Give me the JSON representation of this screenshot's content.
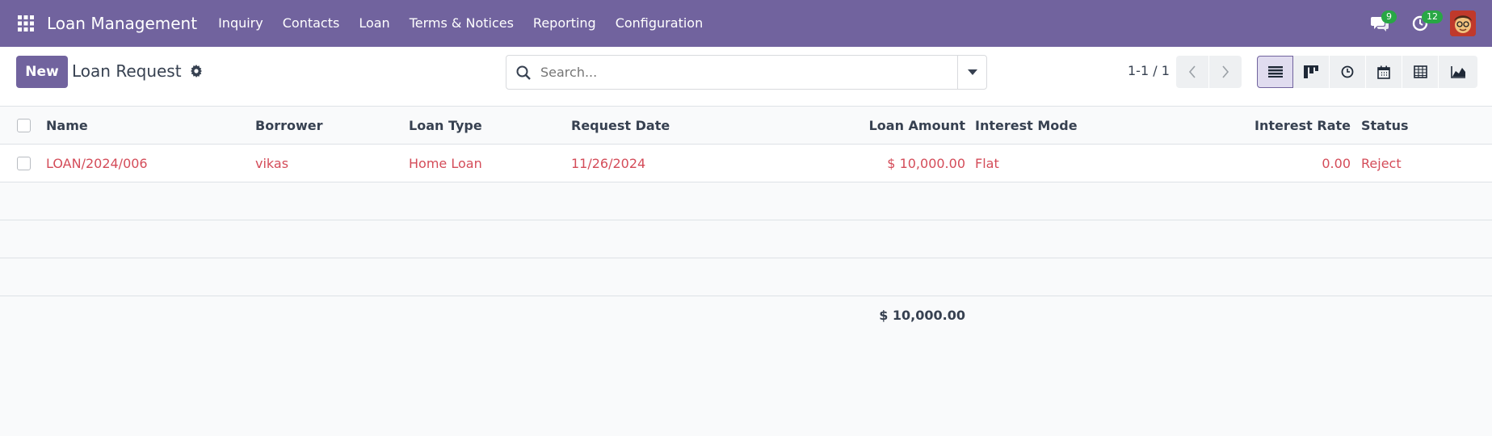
{
  "app": {
    "name": "Loan Management",
    "menu": [
      "Inquiry",
      "Contacts",
      "Loan",
      "Terms & Notices",
      "Reporting",
      "Configuration"
    ],
    "messages_count": "9",
    "activities_count": "12"
  },
  "control": {
    "new_label": "New",
    "breadcrumb": "Loan Request",
    "search_placeholder": "Search...",
    "pager": "1-1 / 1"
  },
  "table": {
    "columns": {
      "name": "Name",
      "borrower": "Borrower",
      "loan_type": "Loan Type",
      "request_date": "Request Date",
      "loan_amount": "Loan Amount",
      "interest_mode": "Interest Mode",
      "interest_rate": "Interest Rate",
      "status": "Status"
    },
    "rows": [
      {
        "name": "LOAN/2024/006",
        "borrower": "vikas",
        "loan_type": "Home Loan",
        "request_date": "11/26/2024",
        "loan_amount": "$ 10,000.00",
        "interest_mode": "Flat",
        "interest_rate": "0.00",
        "status": "Reject"
      }
    ],
    "total_amount": "$ 10,000.00"
  },
  "colors": {
    "brand": "#71639e",
    "row_text": "#d44c59",
    "badge": "#28a745"
  }
}
